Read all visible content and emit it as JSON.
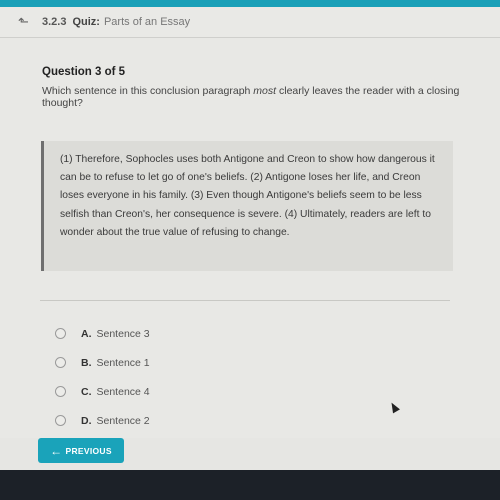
{
  "header": {
    "back_icon": "back-arrow-icon",
    "lesson_number": "3.2.3",
    "activity_type": "Quiz:",
    "title": "Parts of an Essay"
  },
  "question": {
    "counter": "Question 3 of 5",
    "prompt_before": "Which sentence in this conclusion paragraph ",
    "prompt_emphasis": "most",
    "prompt_after": " clearly leaves the reader with a closing thought?",
    "passage": "(1) Therefore, Sophocles uses both Antigone and Creon to show how dangerous it can be to refuse to let go of one's beliefs. (2) Antigone loses her life, and Creon loses everyone in his family. (3) Even though Antigone's beliefs seem to be less selfish than Creon's, her consequence is severe. (4) Ultimately, readers are left to wonder about the true value of refusing to change."
  },
  "options": [
    {
      "letter": "A.",
      "text": "Sentence 3",
      "selected": false
    },
    {
      "letter": "B.",
      "text": "Sentence 1",
      "selected": false
    },
    {
      "letter": "C.",
      "text": "Sentence 4",
      "selected": false
    },
    {
      "letter": "D.",
      "text": "Sentence 2",
      "selected": false
    }
  ],
  "navigation": {
    "previous_label": "PREVIOUS",
    "previous_icon": "arrow-left-icon"
  },
  "colors": {
    "accent": "#1aa3ba"
  }
}
